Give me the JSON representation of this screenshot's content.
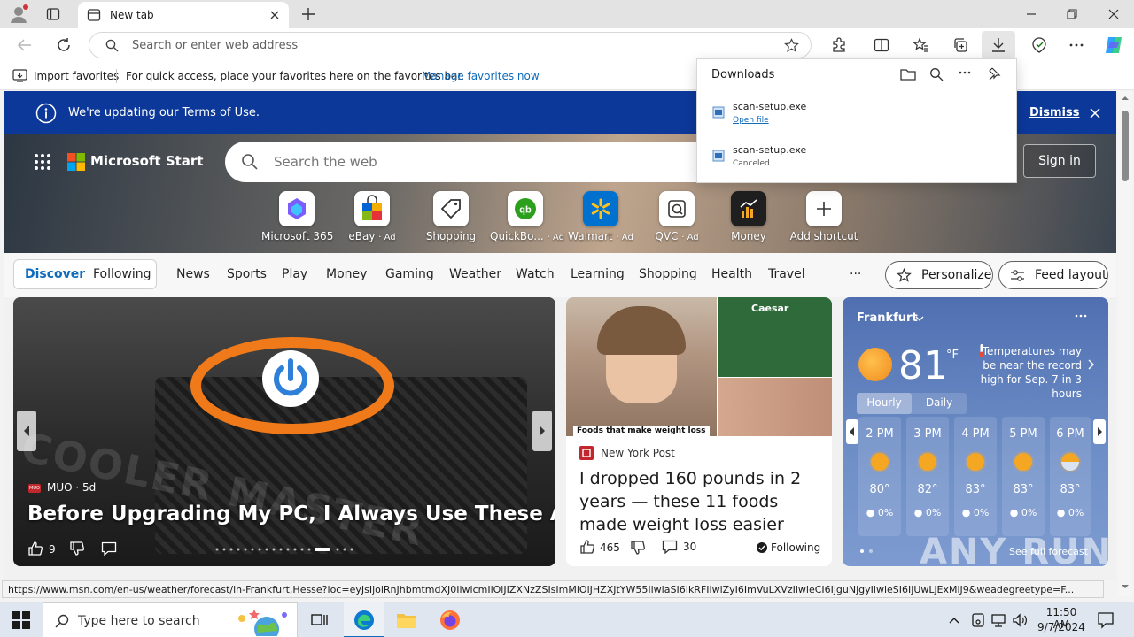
{
  "browser": {
    "tab_title": "New tab",
    "address_placeholder": "Search or enter web address"
  },
  "favorites_bar": {
    "import_label": "Import favorites",
    "hint": "For quick access, place your favorites here on the favorites bar.",
    "manage_link": "Manage favorites now"
  },
  "notice": {
    "text": "We're updating our Terms of Use.",
    "dismiss": "Dismiss"
  },
  "start": {
    "brand": "Microsoft Start",
    "search_placeholder": "Search the web",
    "sign_in": "Sign in"
  },
  "shortcuts": [
    {
      "label": "Microsoft 365",
      "ad": ""
    },
    {
      "label": "eBay",
      "ad": "· Ad"
    },
    {
      "label": "Shopping",
      "ad": ""
    },
    {
      "label": "QuickBo...",
      "ad": "· Ad"
    },
    {
      "label": "Walmart",
      "ad": "· Ad"
    },
    {
      "label": "QVC",
      "ad": "· Ad"
    },
    {
      "label": "Money",
      "ad": ""
    },
    {
      "label": "Add shortcut",
      "ad": ""
    }
  ],
  "feed_nav": {
    "discover": "Discover",
    "following": "Following",
    "links": [
      "News",
      "Sports",
      "Play",
      "Money",
      "Gaming",
      "Weather",
      "Watch",
      "Learning",
      "Shopping",
      "Health",
      "Travel"
    ],
    "more": "···",
    "personalize": "Personalize",
    "feed_layout": "Feed layout"
  },
  "main_card": {
    "source": "MUO · 5d",
    "source_badge": "MUO",
    "headline": "Before Upgrading My PC, I Always Use These Apps",
    "likes": "9",
    "image_text": "COOLER MASTER"
  },
  "news_card": {
    "image_caption": "Foods that make weight loss",
    "image_tag": "Caesar",
    "source": "New York Post",
    "headline": "I dropped 160 pounds in 2 years — these 11 foods made weight loss easier",
    "likes": "465",
    "comments": "30",
    "following": "Following"
  },
  "weather": {
    "city": "Frankfurt",
    "temp": "81",
    "unit": "°F",
    "alert": "Temperatures may be near the record high for Sep. 7 in 3 hours",
    "tab_hourly": "Hourly",
    "tab_daily": "Daily",
    "hours": [
      {
        "time": "2 PM",
        "temp": "80°",
        "precip": "0%"
      },
      {
        "time": "3 PM",
        "temp": "82°",
        "precip": "0%"
      },
      {
        "time": "4 PM",
        "temp": "83°",
        "precip": "0%"
      },
      {
        "time": "5 PM",
        "temp": "83°",
        "precip": "0%"
      },
      {
        "time": "6 PM",
        "temp": "83°",
        "precip": "0%"
      }
    ],
    "full_forecast": "See full forecast"
  },
  "downloads": {
    "title": "Downloads",
    "items": [
      {
        "name": "scan-setup.exe",
        "status": "Open file"
      },
      {
        "name": "scan-setup.exe",
        "status": "Canceled"
      }
    ]
  },
  "status_url": "https://www.msn.com/en-us/weather/forecast/in-Frankfurt,Hesse?loc=eyJsIjoiRnJhbmtmdXJ0IiwicmIiOiJIZXNzZSIsImMiOiJHZXJtYW55IiwiaSI6IkRFIiwiZyI6ImVuLXVzIiwieCI6IjguNjgyIiwieSI6IjUwLjExMiJ9&weadegreetype=F...",
  "watermark": "ANY RUN",
  "taskbar": {
    "search_placeholder": "Type here to search",
    "time": "11:50 AM",
    "date": "9/7/2024"
  },
  "colors": {
    "notice_bg": "#0c3899",
    "accent": "#0f6cbd",
    "weather_sun": "#f5a623"
  }
}
